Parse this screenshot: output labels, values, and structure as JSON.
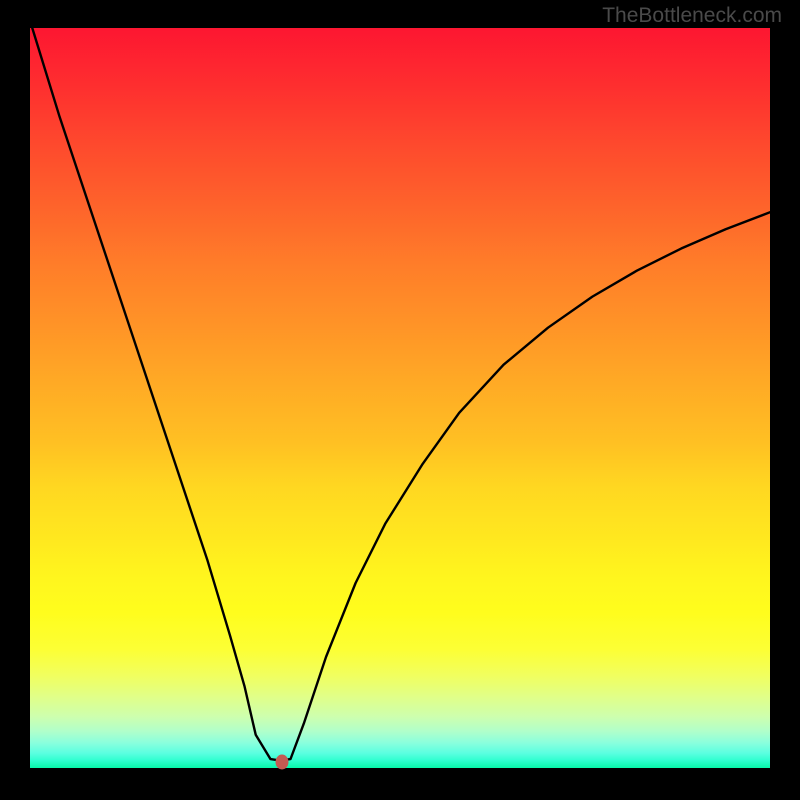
{
  "watermark": "TheBottleneck.com",
  "chart_data": {
    "type": "line",
    "title": "",
    "xlabel": "",
    "ylabel": "",
    "xlim": [
      0,
      100
    ],
    "ylim": [
      0,
      100
    ],
    "series": [
      {
        "name": "curve",
        "x": [
          0,
          4,
          8,
          12,
          16,
          20,
          24,
          27,
          29,
          30.5,
          32.5,
          33.8,
          35.2,
          37,
          40,
          44,
          48,
          53,
          58,
          64,
          70,
          76,
          82,
          88,
          94,
          100
        ],
        "y": [
          101,
          88,
          76,
          64,
          52,
          40,
          28,
          18,
          11,
          4.5,
          1.2,
          1.0,
          1.2,
          6,
          15,
          25,
          33,
          41,
          48,
          54.5,
          59.5,
          63.7,
          67.2,
          70.2,
          72.8,
          75.1
        ]
      }
    ],
    "marker": {
      "x": 34.0,
      "y": 0.8
    },
    "background_gradient": {
      "top": "#fd1631",
      "middle": "#ffe81f",
      "bottom": "#07f8aa"
    }
  }
}
